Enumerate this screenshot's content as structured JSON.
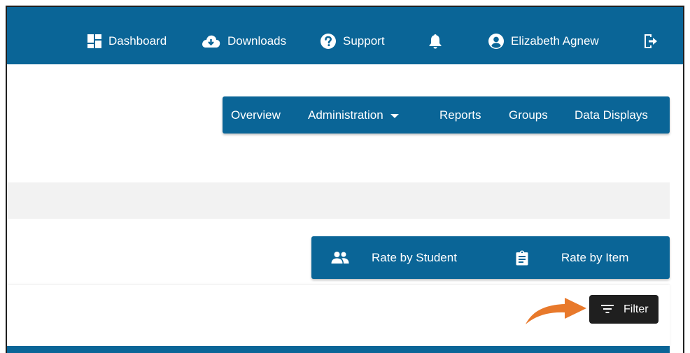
{
  "header": {
    "items": [
      {
        "label": "Dashboard",
        "icon": "dashboard-icon"
      },
      {
        "label": "Downloads",
        "icon": "cloud-download-icon"
      },
      {
        "label": "Support",
        "icon": "help-circle-icon"
      },
      {
        "label": "",
        "icon": "bell-icon"
      },
      {
        "label": "Elizabeth Agnew",
        "icon": "user-circle-icon"
      },
      {
        "label": "",
        "icon": "logout-icon"
      }
    ]
  },
  "nav": {
    "items": [
      {
        "label": "Overview"
      },
      {
        "label": "Administration",
        "has_dropdown": true
      },
      {
        "label": "Reports"
      },
      {
        "label": "Groups"
      },
      {
        "label": "Data Displays"
      }
    ]
  },
  "rate_toolbar": {
    "items": [
      {
        "label": "Rate by Student",
        "icon": "people-icon"
      },
      {
        "label": "Rate by Item",
        "icon": "clipboard-icon"
      }
    ]
  },
  "filter": {
    "label": "Filter",
    "icon": "filter-lines-icon"
  },
  "colors": {
    "brand_blue": "#0a6597",
    "filter_button": "#1f1f1f",
    "annotation_arrow": "#e8792b",
    "strip_grey": "#f2f2f2"
  }
}
